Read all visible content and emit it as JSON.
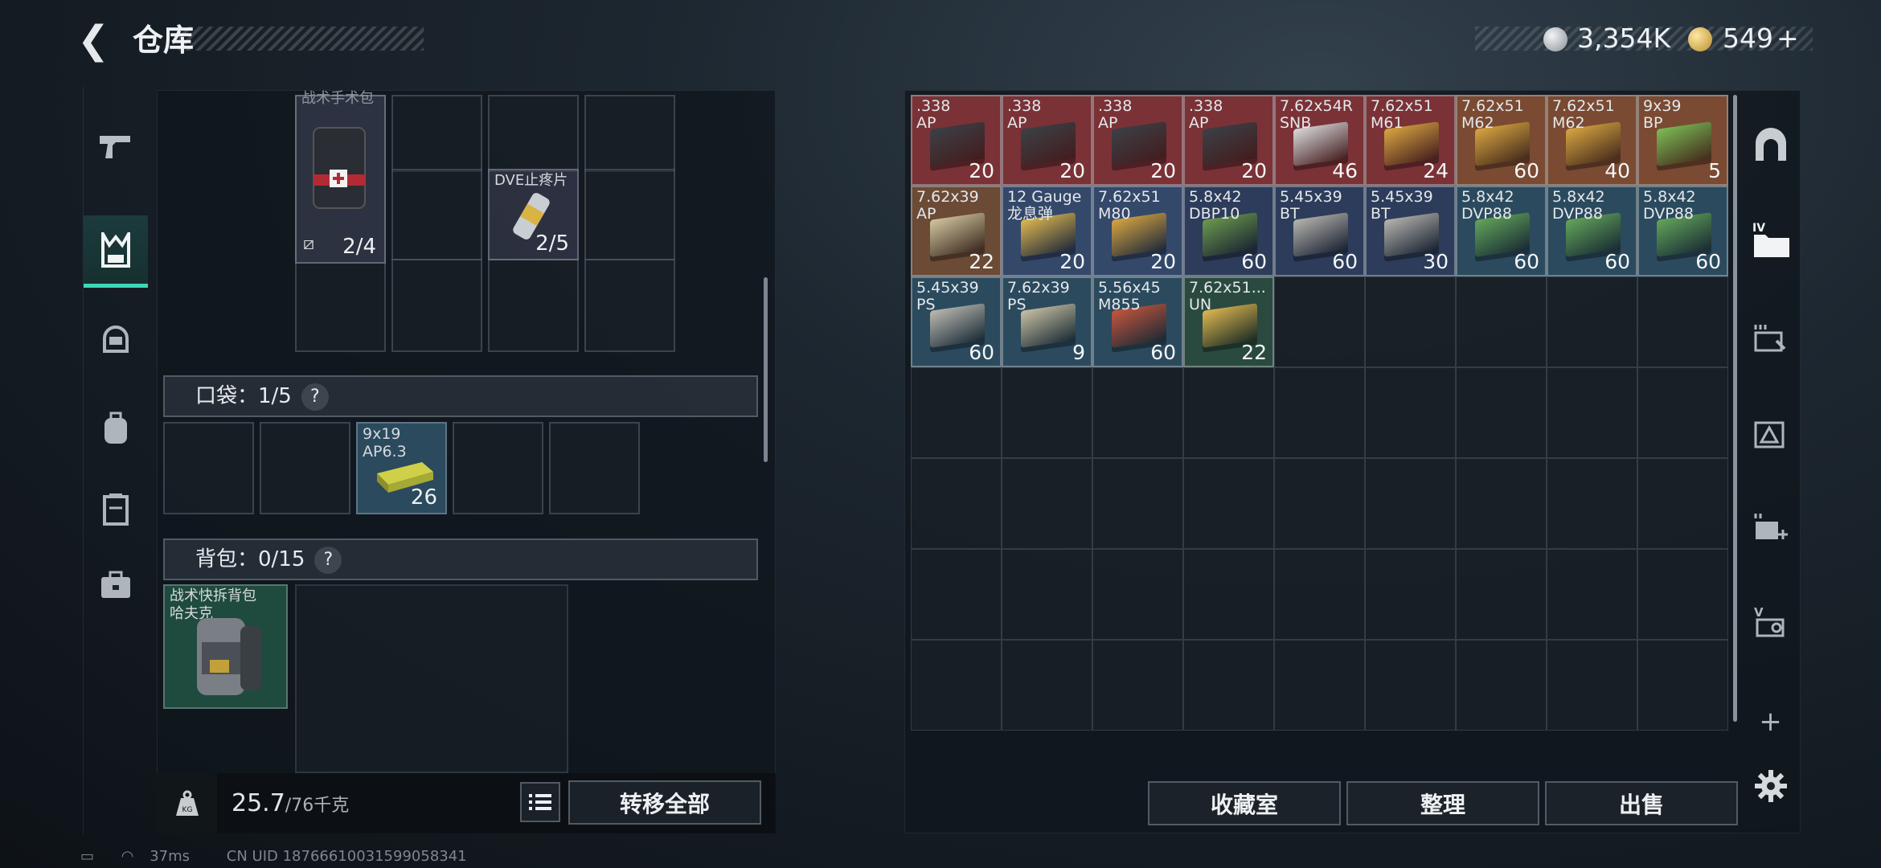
{
  "header": {
    "back_icon": "chevron-left-icon",
    "title": "仓库",
    "currency1": "3,354K",
    "currency2": "549",
    "plus": "+"
  },
  "left_nav": [
    {
      "icon": "pistol-icon"
    },
    {
      "icon": "vest-icon",
      "active": true
    },
    {
      "icon": "helmet-icon"
    },
    {
      "icon": "backpack-icon"
    },
    {
      "icon": "container-icon"
    },
    {
      "icon": "briefcase-icon"
    }
  ],
  "vest": {
    "items": [
      {
        "name": "战术手术包",
        "count": "2/4",
        "note": "broken-icon"
      },
      {
        "name": "DVE止疼片",
        "count": "2/5"
      }
    ]
  },
  "pocket": {
    "label": "口袋：1/5",
    "help": "?",
    "item": {
      "name": "9x19\nAP6.3",
      "count": "26"
    }
  },
  "backpack": {
    "label": "背包：0/15",
    "help": "?",
    "item": {
      "name": "战术快拆背包\n哈夫克"
    }
  },
  "bottom": {
    "weight": "25.7",
    "weight_max": "/76千克",
    "kg_label": "KG",
    "transfer": "转移全部"
  },
  "storage": {
    "items": [
      {
        "name": ".338\nAP",
        "qty": "20",
        "bg": "#7a3236"
      },
      {
        "name": ".338\nAP",
        "qty": "20",
        "bg": "#7a3236"
      },
      {
        "name": ".338\nAP",
        "qty": "20",
        "bg": "#7a3236"
      },
      {
        "name": ".338\nAP",
        "qty": "20",
        "bg": "#7a3236"
      },
      {
        "name": "7.62x54R\nSNB",
        "qty": "46",
        "bg": "#7a3236"
      },
      {
        "name": "7.62x51\nM61",
        "qty": "24",
        "bg": "#7a3236"
      },
      {
        "name": "7.62x51\nM62",
        "qty": "60",
        "bg": "#7a4a32"
      },
      {
        "name": "7.62x51\nM62",
        "qty": "40",
        "bg": "#7a4a32"
      },
      {
        "name": "9x39\nBP",
        "qty": "5",
        "bg": "#7a4a32"
      },
      {
        "name": "7.62x39\nAP",
        "qty": "22",
        "bg": "#6b4a36"
      },
      {
        "name": "12 Gauge\n龙息弹",
        "qty": "20",
        "bg": "#34486a"
      },
      {
        "name": "7.62x51\nM80",
        "qty": "20",
        "bg": "#34486a"
      },
      {
        "name": "5.8x42\nDBP10",
        "qty": "60",
        "bg": "#2d3c5a"
      },
      {
        "name": "5.45x39\nBT",
        "qty": "60",
        "bg": "#2d3c5a"
      },
      {
        "name": "5.45x39\nBT",
        "qty": "30",
        "bg": "#2d3c5a"
      },
      {
        "name": "5.8x42\nDVP88",
        "qty": "60",
        "bg": "#2b4a5e"
      },
      {
        "name": "5.8x42\nDVP88",
        "qty": "60",
        "bg": "#2b4a5e"
      },
      {
        "name": "5.8x42\nDVP88",
        "qty": "60",
        "bg": "#2b4a5e"
      },
      {
        "name": "5.45x39\nPS",
        "qty": "60",
        "bg": "#2b4a5e"
      },
      {
        "name": "7.62x39\nPS",
        "qty": "9",
        "bg": "#2b4a5e"
      },
      {
        "name": "5.56x45\nM855",
        "qty": "60",
        "bg": "#2b4a5e"
      },
      {
        "name": "7.62x51...\nUN",
        "qty": "22",
        "bg": "#2a4a40"
      }
    ],
    "buttons": {
      "collection": "收藏室",
      "sort": "整理",
      "sell": "出售"
    }
  },
  "right_nav": [
    {
      "icon": "arch-icon"
    },
    {
      "icon": "folder-icon",
      "label": "IV"
    },
    {
      "icon": "stash-tab-icon"
    },
    {
      "icon": "alert-tab-icon"
    },
    {
      "icon": "add-tab-icon"
    },
    {
      "icon": "v-tab-icon",
      "label": "V"
    },
    {
      "icon": "plus-icon",
      "label": "+"
    },
    {
      "icon": "gear-icon"
    }
  ],
  "status": {
    "ping": "37ms",
    "uid": "CN UID 18766610031599058341"
  }
}
